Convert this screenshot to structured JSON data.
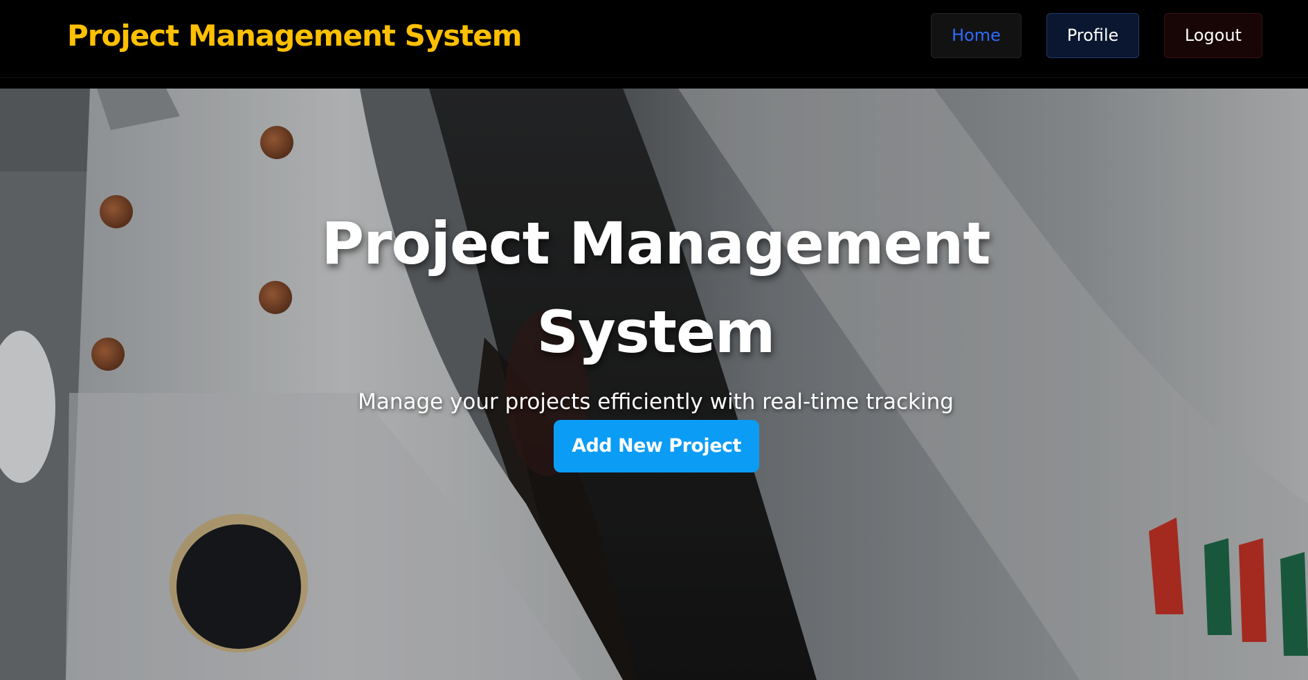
{
  "navbar": {
    "brand": "Project Management System",
    "links": {
      "home": "Home",
      "profile": "Profile",
      "logout": "Logout"
    }
  },
  "hero": {
    "title_line1": "Project Management",
    "title_line2": "System",
    "subtitle": "Manage your projects efficiently with real-time tracking",
    "cta_label": "Add New Project"
  },
  "colors": {
    "brand": "#ffc000",
    "active_link": "#2e6bff",
    "cta": "#0b9cf5",
    "navbar_bg": "#000000"
  }
}
